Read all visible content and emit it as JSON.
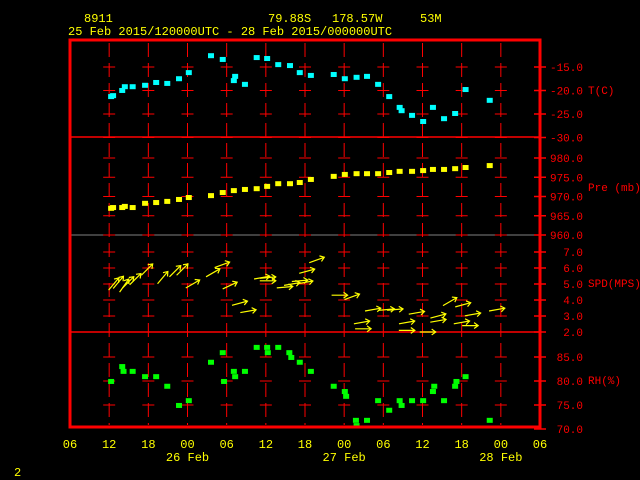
{
  "header": {
    "station": "8911",
    "lat": "79.88S",
    "lon": "178.57W",
    "elev": "53M",
    "period": "25 Feb 2015/120000UTC - 28 Feb 2015/000000UTC"
  },
  "page_number": "2",
  "colors": {
    "frame": "#ff0000",
    "temp": "#00ffff",
    "pres": "#ffff00",
    "wind": "#ffff00",
    "rh": "#00ff00",
    "grid_minor": "#808080"
  },
  "chart_data": {
    "type": "scatter",
    "title": "8911  79.88S 178.57W 53M",
    "x_unit": "hours since 25 Feb 2015 00UTC",
    "xlim": [
      6,
      78
    ],
    "x_tick_labels": [
      "06",
      "12",
      "18",
      "00",
      "06",
      "12",
      "18",
      "00",
      "06",
      "12",
      "18",
      "00",
      "06"
    ],
    "date_labels": [
      {
        "label": "26 Feb",
        "hour": 24
      },
      {
        "label": "27 Feb",
        "hour": 48
      },
      {
        "label": "28 Feb",
        "hour": 72
      }
    ],
    "grid": true,
    "panels": {
      "temp": {
        "label": "T(C)",
        "ylim": [
          -30,
          -12
        ],
        "ticks": [
          "-15.0",
          "-20.0",
          "-25.0",
          "-30.0"
        ],
        "tick_values": [
          -15,
          -20,
          -25,
          -30
        ],
        "points": [
          [
            12.3,
            -21.4
          ],
          [
            12.6,
            -21.2
          ],
          [
            14.0,
            -20.1
          ],
          [
            14.4,
            -19.3
          ],
          [
            15.6,
            -19.3
          ],
          [
            17.5,
            -19.0
          ],
          [
            19.2,
            -18.4
          ],
          [
            20.9,
            -18.6
          ],
          [
            22.7,
            -17.6
          ],
          [
            24.2,
            -16.3
          ],
          [
            27.6,
            -12.7
          ],
          [
            29.4,
            -13.5
          ],
          [
            31.3,
            -17.1
          ],
          [
            31.1,
            -18.0
          ],
          [
            32.8,
            -18.8
          ],
          [
            34.6,
            -13.1
          ],
          [
            36.2,
            -13.3
          ],
          [
            37.9,
            -14.6
          ],
          [
            39.7,
            -14.8
          ],
          [
            41.2,
            -16.3
          ],
          [
            42.9,
            -16.9
          ],
          [
            46.4,
            -16.7
          ],
          [
            48.1,
            -17.6
          ],
          [
            49.9,
            -17.3
          ],
          [
            51.5,
            -17.1
          ],
          [
            53.2,
            -18.8
          ],
          [
            54.9,
            -21.4
          ],
          [
            56.5,
            -23.7
          ],
          [
            56.8,
            -24.4
          ],
          [
            58.4,
            -25.4
          ],
          [
            60.1,
            -26.7
          ],
          [
            61.6,
            -23.7
          ],
          [
            63.3,
            -26.1
          ],
          [
            65.0,
            -25.0
          ],
          [
            66.6,
            -19.9
          ],
          [
            70.3,
            -22.2
          ]
        ]
      },
      "pres": {
        "label": "Pre (mb)",
        "ylim": [
          960,
          985.5
        ],
        "ticks": [
          "980.0",
          "975.0",
          "970.0",
          "965.0",
          "960.0"
        ],
        "tick_values": [
          980,
          975,
          970,
          965,
          960
        ],
        "points": [
          [
            12.3,
            966.8
          ],
          [
            12.6,
            967.0
          ],
          [
            14.0,
            967.0
          ],
          [
            14.4,
            967.3
          ],
          [
            15.6,
            967.0
          ],
          [
            17.5,
            968.1
          ],
          [
            19.2,
            968.3
          ],
          [
            20.9,
            968.6
          ],
          [
            22.7,
            969.1
          ],
          [
            24.2,
            969.6
          ],
          [
            27.6,
            970.1
          ],
          [
            29.4,
            970.9
          ],
          [
            31.1,
            971.4
          ],
          [
            32.8,
            971.7
          ],
          [
            34.6,
            971.9
          ],
          [
            36.2,
            972.5
          ],
          [
            37.9,
            973.2
          ],
          [
            39.7,
            973.2
          ],
          [
            41.2,
            973.5
          ],
          [
            42.9,
            974.3
          ],
          [
            46.4,
            975.1
          ],
          [
            48.1,
            975.6
          ],
          [
            49.9,
            975.8
          ],
          [
            51.5,
            975.8
          ],
          [
            53.2,
            975.8
          ],
          [
            54.9,
            976.1
          ],
          [
            56.5,
            976.4
          ],
          [
            58.4,
            976.4
          ],
          [
            60.1,
            976.6
          ],
          [
            61.6,
            976.9
          ],
          [
            63.3,
            976.9
          ],
          [
            65.0,
            977.1
          ],
          [
            66.6,
            977.4
          ],
          [
            70.3,
            977.9
          ]
        ]
      },
      "wind": {
        "label": "SPD(MPS)",
        "ylim": [
          2,
          8
        ],
        "ticks": [
          "7.0",
          "6.0",
          "5.0",
          "4.0",
          "3.0",
          "2.0"
        ],
        "tick_values": [
          7,
          6,
          5,
          4,
          3,
          2
        ],
        "points_note": "[hour, speed m/s, arrow bearing deg counter-clockwise from east]",
        "points": [
          [
            12.7,
            5.0,
            50
          ],
          [
            13.4,
            5.1,
            50
          ],
          [
            14.3,
            4.9,
            55
          ],
          [
            14.9,
            5.1,
            45
          ],
          [
            16.0,
            5.3,
            45
          ],
          [
            17.8,
            5.9,
            45
          ],
          [
            20.2,
            5.4,
            50
          ],
          [
            22.1,
            5.8,
            45
          ],
          [
            23.2,
            5.9,
            45
          ],
          [
            24.8,
            5.0,
            30
          ],
          [
            27.9,
            5.7,
            30
          ],
          [
            29.3,
            6.2,
            20
          ],
          [
            30.5,
            4.9,
            25
          ],
          [
            32.0,
            3.8,
            15
          ],
          [
            33.3,
            3.3,
            10
          ],
          [
            35.4,
            5.4,
            10
          ],
          [
            36.3,
            5.2,
            0
          ],
          [
            36.3,
            5.4,
            5
          ],
          [
            38.9,
            4.8,
            5
          ],
          [
            40.0,
            5.0,
            10
          ],
          [
            41.2,
            5.2,
            5
          ],
          [
            42.3,
            5.8,
            15
          ],
          [
            42.0,
            5.1,
            10
          ],
          [
            43.8,
            6.5,
            20
          ],
          [
            47.3,
            4.3,
            0
          ],
          [
            49.2,
            4.2,
            20
          ],
          [
            50.7,
            2.6,
            10
          ],
          [
            50.9,
            2.2,
            0
          ],
          [
            52.4,
            3.4,
            10
          ],
          [
            54.5,
            3.4,
            5
          ],
          [
            55.8,
            3.4,
            5
          ],
          [
            57.6,
            2.6,
            10
          ],
          [
            57.6,
            2.1,
            0
          ],
          [
            59.1,
            3.2,
            10
          ],
          [
            60.8,
            2.0,
            0
          ],
          [
            62.4,
            3.0,
            15
          ],
          [
            62.4,
            2.7,
            10
          ],
          [
            64.2,
            3.9,
            30
          ],
          [
            66.2,
            3.7,
            15
          ],
          [
            66.0,
            2.6,
            10
          ],
          [
            67.7,
            3.1,
            10
          ],
          [
            67.3,
            2.4,
            0
          ],
          [
            71.4,
            3.4,
            10
          ]
        ]
      },
      "rh": {
        "label": "RH(%)",
        "ylim": [
          70,
          90
        ],
        "ticks": [
          "85.0",
          "80.0",
          "75.0",
          "70.0"
        ],
        "tick_values": [
          85,
          80,
          75,
          70
        ],
        "points": [
          [
            12.3,
            79.8
          ],
          [
            14.0,
            82.9
          ],
          [
            14.2,
            81.9
          ],
          [
            15.6,
            81.9
          ],
          [
            17.5,
            80.8
          ],
          [
            19.2,
            80.8
          ],
          [
            20.9,
            78.8
          ],
          [
            22.7,
            74.8
          ],
          [
            24.2,
            75.8
          ],
          [
            27.6,
            83.8
          ],
          [
            29.4,
            85.8
          ],
          [
            29.6,
            79.8
          ],
          [
            31.1,
            81.9
          ],
          [
            31.3,
            80.8
          ],
          [
            32.8,
            81.9
          ],
          [
            34.6,
            86.9
          ],
          [
            36.2,
            86.9
          ],
          [
            36.3,
            85.8
          ],
          [
            37.9,
            86.9
          ],
          [
            39.6,
            85.8
          ],
          [
            39.9,
            84.8
          ],
          [
            41.2,
            83.8
          ],
          [
            42.9,
            81.9
          ],
          [
            46.4,
            78.8
          ],
          [
            48.1,
            77.7
          ],
          [
            48.3,
            76.7
          ],
          [
            49.8,
            71.7
          ],
          [
            49.9,
            70.6
          ],
          [
            51.5,
            71.7
          ],
          [
            53.2,
            75.8
          ],
          [
            54.9,
            73.8
          ],
          [
            56.5,
            75.8
          ],
          [
            56.8,
            74.8
          ],
          [
            58.4,
            75.8
          ],
          [
            60.1,
            75.8
          ],
          [
            61.6,
            77.7
          ],
          [
            61.8,
            78.8
          ],
          [
            63.3,
            75.8
          ],
          [
            65.0,
            78.8
          ],
          [
            65.2,
            79.8
          ],
          [
            66.6,
            80.8
          ],
          [
            70.3,
            71.7
          ]
        ]
      }
    }
  }
}
